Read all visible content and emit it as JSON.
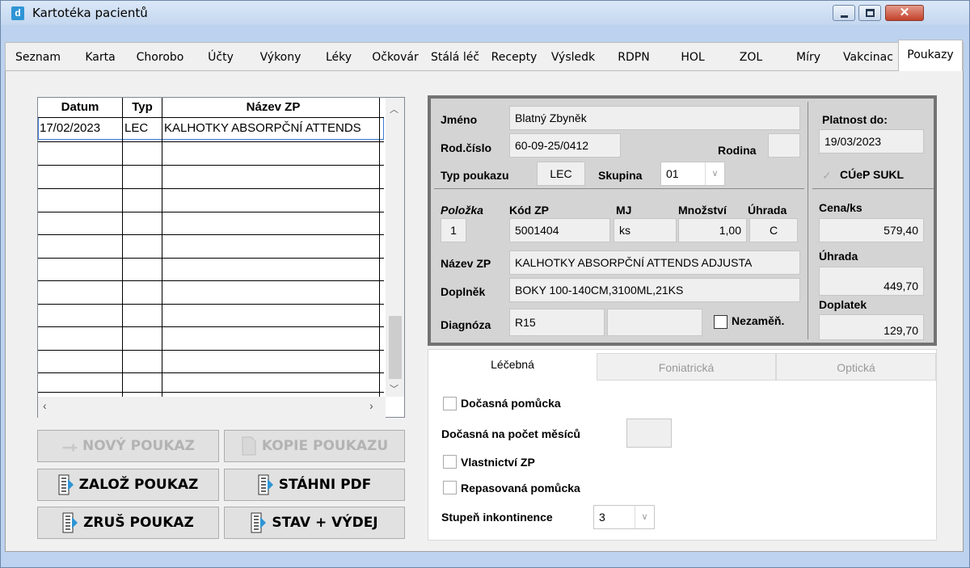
{
  "window": {
    "title": "Kartotéka pacientů"
  },
  "tabs": [
    "Seznam",
    "Karta",
    "Chorobo",
    "Účty",
    "Výkony",
    "Léky",
    "Očkovár",
    "Stálá léč",
    "Recepty",
    "Výsledk",
    "RDPN",
    "HOL",
    "ZOL",
    "Míry",
    "Vakcinac",
    "Poukazy"
  ],
  "grid": {
    "columns": [
      "Datum",
      "Typ",
      "Název ZP"
    ],
    "rows": [
      {
        "datum": "17/02/2023",
        "typ": "LEC",
        "nazev": "KALHOTKY ABSORPČNÍ ATTENDS"
      }
    ]
  },
  "buttons": {
    "new": "NOVÝ POUKAZ",
    "copy": "KOPIE POUKAZU",
    "create": "ZALOŽ POUKAZ",
    "download": "STÁHNI PDF",
    "cancel": "ZRUŠ POUKAZ",
    "status": "STAV + VÝDEJ"
  },
  "form": {
    "labels": {
      "jmeno": "Jméno",
      "rodcislo": "Rod.číslo",
      "rodina": "Rodina",
      "typpoukazu": "Typ poukazu",
      "skupina": "Skupina",
      "polozka": "Položka",
      "kodzp": "Kód ZP",
      "mj": "MJ",
      "mnozstvi": "Množství",
      "uhrada": "Úhrada",
      "nazevzp": "Název ZP",
      "doplnek": "Doplněk",
      "diagnoza": "Diagnóza",
      "nezamen": "Nezaměň.",
      "platnost": "Platnost do:",
      "cueп": "CÚeP SUKL",
      "cena": "Cena/ks",
      "uhrada2": "Úhrada",
      "doplatek": "Doplatek"
    },
    "values": {
      "jmeno": "Blatný Zbyněk",
      "rodcislo": "60-09-25/0412",
      "rodina": "",
      "typpoukazu": "LEC",
      "skupina": "01",
      "polozka": "1",
      "kodzp": "5001404",
      "mj": "ks",
      "mnozstvi": "1,00",
      "uhrada": "C",
      "nazevzp": "KALHOTKY ABSORPČNÍ ATTENDS ADJUSTA",
      "doplnek": "BOKY 100-140CM,3100ML,21KS",
      "diagnoza": "R15",
      "diagnoza2": "",
      "platnost": "19/03/2023",
      "cena": "579,40",
      "uhrada2": "449,70",
      "doplatek": "129,70"
    }
  },
  "lower": {
    "tabs": [
      "Léčebná",
      "Foniatrická",
      "Optická"
    ],
    "checks": [
      "Dočasná pomůcka",
      "Vlastnictví ZP",
      "Repasovaná pomůcka"
    ],
    "months_label": "Dočasná na počet měsíců",
    "months_value": "",
    "incont_label": "Stupeň inkontinence",
    "incont_value": "3"
  }
}
